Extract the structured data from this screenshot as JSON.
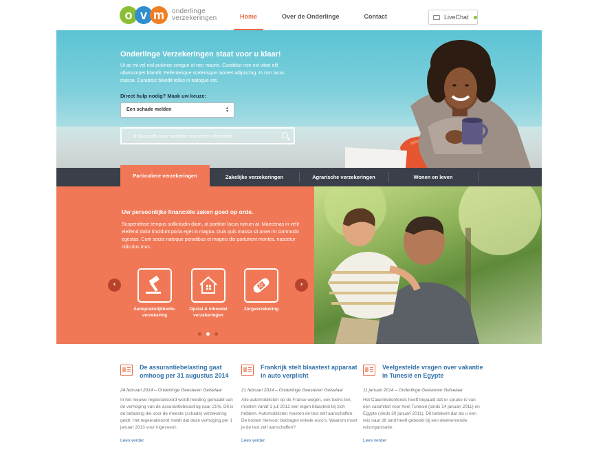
{
  "header": {
    "logo_letters": [
      "o",
      "v",
      "m"
    ],
    "logo_line1": "onderlinge",
    "logo_line2": "verzekeringen",
    "nav": [
      "Home",
      "Over de Onderlinge",
      "Contact"
    ],
    "livechat": "LiveChat"
  },
  "hero": {
    "title": "Onderlinge Verzekeringen staat voor u klaar!",
    "text": "Ut ac mi vel nisl pulvinar congue ut nec mauris. Curabitur non est vitae elit ullamcorper blandit. Pellentesque scelerisque laoreet adipiscing. In non lacus massa. Curabitur blandit tellus in natogue est.",
    "help_label": "Direct hulp nodig? Maak uw keuze:",
    "select_value": "Een schade melden",
    "search_placeholder": "... of doorzoek onze website voor meer informatie"
  },
  "tabs": [
    "Particuliere verzekeringen",
    "Zakelijke verzekeringen",
    "Agrarische verzekeringen",
    "Wonen en leven"
  ],
  "feature": {
    "title": "Uw persoonlijke financiële zaken goed op orde.",
    "text": "Suspendisse tempus sollicitudin diam, at porttitor lacus rutrum at. Maecenas in velit eleifend dolor tincidunt porta eget in magna. Duis quis massa sit amet mi commodo egestas. Cum sociis natoque penatibus et magnis dis parturient montes, nascetur ridiculus mus.",
    "items": [
      {
        "line1": "Aansprakelijkheids-",
        "line2": "verzekering"
      },
      {
        "line1": "Opstal & inboedel",
        "line2": "verzekeringen"
      },
      {
        "line1": "Zorgverzekering",
        "line2": ""
      }
    ]
  },
  "news": [
    {
      "title": "De assurantiebelasting gaat omhoog per 31 augustus 2014",
      "meta": "24 februari 2014 – Onderlinge Geesteren Gelselaar",
      "text": "In het nieuwe regeerakkoord wordt melding gemaakt van de verhoging van de assurantiebelasting naar 21%. Dit is de belasting die voor de meeste  (schade) verzekering geldt. Het regeerakkoord meldt dat deze verhoging per 1 januari 2013 voor ingevoerd.",
      "more": "Lees verder"
    },
    {
      "title": "Frankrijk stelt blaastest apparaat in auto verplicht",
      "meta": "21 februari 2014 – Onderlinge Geesteren Gelselaar",
      "text": "Alle automobilisten op de Franse wegen, ook toeris-ten, moeten vanaf 1 juli 2012 een eigen blaastest bij zich hebben. Automobilisten moeten de test zelf aanschaffen. De kosten hiervoor bedragen enkele euro's. Waarom moet je de test zelf aanschaffen?",
      "more": "Lees verder"
    },
    {
      "title": "Veelgestelde vragen over vakantie in Tunesië en Egypte",
      "meta": "11 januari 2014 – Onderlinge Geesteren Gelselaar",
      "text": "Het Calamiteitenfonds heeft bepaald dat er sprake is van een calamiteit voor heel Tunesië (sinds 14 januari 2011) en Egypte (sinds 30 januari 2011). Dit betekent dat als u een reis naar dit land heeft geboekt bij een deelnemende reisorganisatie.",
      "more": "Lees verder"
    }
  ]
}
